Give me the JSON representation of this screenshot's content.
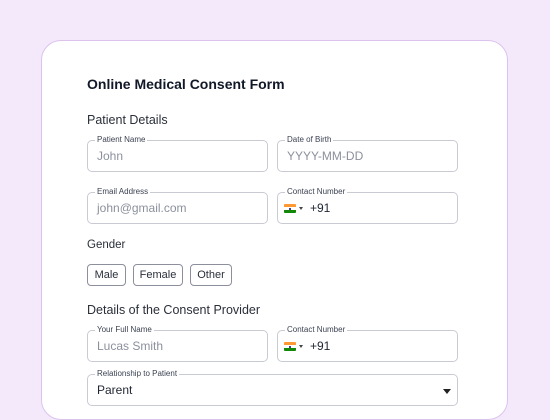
{
  "form": {
    "title": "Online Medical Consent Form",
    "patient_section": "Patient Details",
    "patient_name_label": "Patient Name",
    "patient_name_placeholder": "John",
    "dob_label": "Date of Birth",
    "dob_placeholder": "YYYY-MM-DD",
    "email_label": "Email Address",
    "email_placeholder": "john@gmail.com",
    "contact_label": "Contact Number",
    "contact_code": "+91",
    "gender_label": "Gender",
    "gender_options": [
      "Male",
      "Female",
      "Other"
    ],
    "provider_section": "Details of the Consent Provider",
    "full_name_label": "Your Full Name",
    "full_name_placeholder": "Lucas Smith",
    "provider_contact_label": "Contact Number",
    "provider_contact_code": "+91",
    "relationship_label": "Relationship to Patient",
    "relationship_value": "Parent"
  },
  "icons": {
    "country_flag": "india-flag-icon",
    "dropdown": "chevron-down-icon"
  },
  "colors": {
    "background": "#f3e9fb",
    "card_border": "#dcc3ee"
  }
}
